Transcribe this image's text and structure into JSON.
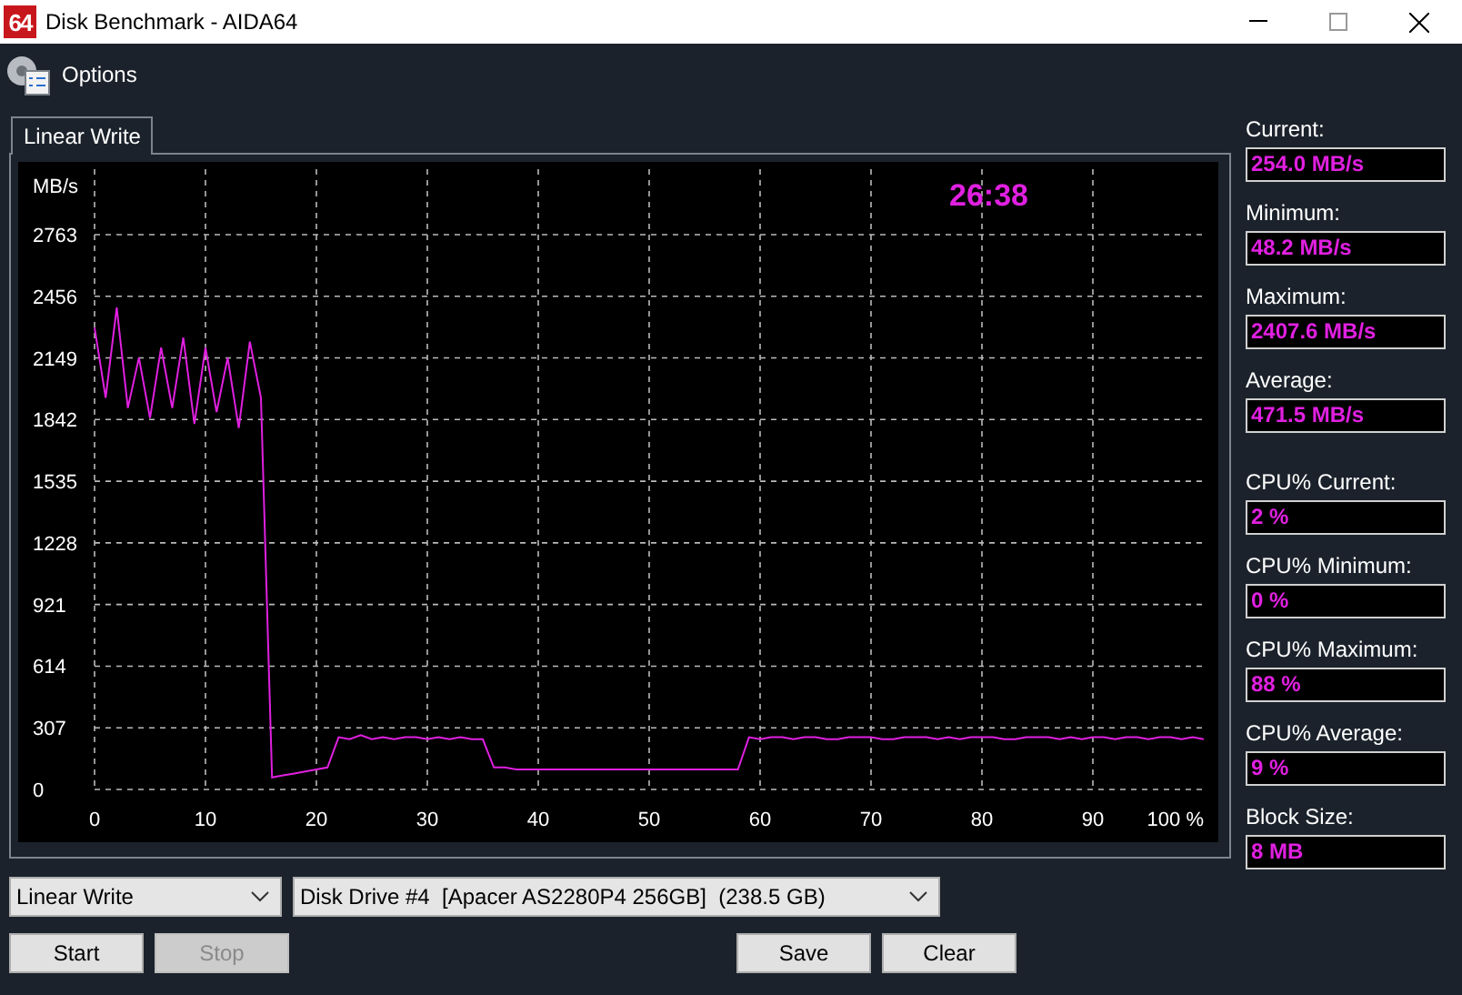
{
  "window": {
    "title": "Disk Benchmark - AIDA64",
    "icon_text": "64"
  },
  "toolbar": {
    "label": "Options"
  },
  "tabs": [
    {
      "label": "Linear Write",
      "selected": true
    }
  ],
  "chart": {
    "chart_data": {
      "type": "line",
      "grid": true,
      "ylabel": "MB/s",
      "xlim": [
        0,
        100
      ],
      "ylim": [
        0,
        3089
      ],
      "xticks": [
        0,
        10,
        20,
        30,
        40,
        50,
        60,
        70,
        80,
        90,
        {
          "value": 100,
          "label": "100 %"
        }
      ],
      "yticks": [
        0,
        307,
        614,
        921,
        1228,
        1535,
        1842,
        2149,
        2456,
        2763
      ],
      "x": [
        0,
        1,
        2,
        3,
        4,
        5,
        6,
        7,
        8,
        9,
        10,
        11,
        12,
        13,
        14,
        15,
        16,
        17,
        18,
        19,
        20,
        21,
        22,
        23,
        24,
        25,
        26,
        27,
        28,
        29,
        30,
        31,
        32,
        33,
        34,
        35,
        36,
        37,
        38,
        39,
        40,
        41,
        42,
        43,
        44,
        45,
        46,
        47,
        48,
        49,
        50,
        51,
        52,
        53,
        54,
        55,
        56,
        57,
        58,
        59,
        60,
        61,
        62,
        63,
        64,
        65,
        66,
        67,
        68,
        69,
        70,
        71,
        72,
        73,
        74,
        75,
        76,
        77,
        78,
        79,
        80,
        81,
        82,
        83,
        84,
        85,
        86,
        87,
        88,
        89,
        90,
        91,
        92,
        93,
        94,
        95,
        96,
        97,
        98,
        99,
        100
      ],
      "series": [
        {
          "color": "#e020e0",
          "values": [
            2300,
            1950,
            2400,
            1900,
            2150,
            1850,
            2200,
            1900,
            2250,
            1820,
            2200,
            1880,
            2150,
            1800,
            2230,
            1950,
            60,
            70,
            80,
            90,
            100,
            110,
            260,
            250,
            270,
            250,
            260,
            250,
            260,
            260,
            250,
            260,
            250,
            260,
            250,
            250,
            110,
            110,
            100,
            100,
            100,
            100,
            100,
            100,
            100,
            100,
            100,
            100,
            100,
            100,
            100,
            100,
            100,
            100,
            100,
            100,
            100,
            100,
            100,
            260,
            250,
            260,
            260,
            250,
            260,
            260,
            250,
            250,
            260,
            260,
            260,
            250,
            250,
            260,
            260,
            260,
            250,
            260,
            250,
            260,
            260,
            260,
            250,
            250,
            260,
            260,
            260,
            250,
            260,
            250,
            260,
            260,
            250,
            260,
            260,
            250,
            260,
            260,
            250,
            260,
            250
          ]
        }
      ],
      "annotations": [
        {
          "text": "26:38"
        }
      ]
    }
  },
  "test_select": {
    "value": "Linear Write"
  },
  "drive_select": {
    "value": "Disk Drive #4  [Apacer AS2280P4 256GB]  (238.5 GB)"
  },
  "buttons_left": [
    {
      "label": "Start",
      "disabled": false
    },
    {
      "label": "Stop",
      "disabled": true
    }
  ],
  "buttons_right": [
    {
      "label": "Save",
      "disabled": false
    },
    {
      "label": "Clear",
      "disabled": false
    }
  ],
  "stat_groups": [
    {
      "items": [
        {
          "label": "Current:",
          "value": "254.0 MB/s"
        },
        {
          "label": "Minimum:",
          "value": "48.2 MB/s"
        },
        {
          "label": "Maximum:",
          "value": "2407.6 MB/s"
        },
        {
          "label": "Average:",
          "value": "471.5 MB/s"
        }
      ]
    },
    {
      "items": [
        {
          "label": "CPU% Current:",
          "value": "2 %"
        },
        {
          "label": "CPU% Minimum:",
          "value": "0 %"
        },
        {
          "label": "CPU% Maximum:",
          "value": "88 %"
        },
        {
          "label": "CPU% Average:",
          "value": "9 %"
        },
        {
          "label": "Block Size:",
          "value": "8 MB"
        }
      ]
    }
  ]
}
